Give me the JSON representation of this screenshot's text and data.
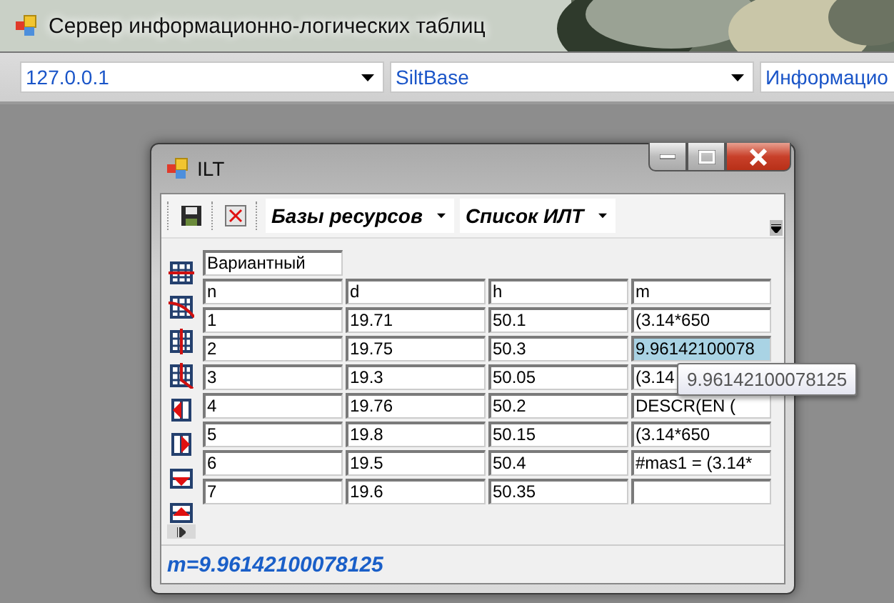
{
  "main_window": {
    "title": "Сервер информационно-логических таблиц",
    "combos": [
      "127.0.0.1",
      "SiltBase",
      "Информацио"
    ]
  },
  "ilt_window": {
    "title": "ILT",
    "toolbar_combos": [
      "Базы ресурсов",
      "Список ИЛТ"
    ],
    "grid": {
      "caption": "Вариантный",
      "columns": [
        "n",
        "d",
        "h",
        "m"
      ],
      "rows": [
        {
          "cells": [
            "1",
            "19.71",
            "50.1",
            "(3.14*650"
          ],
          "selected": false
        },
        {
          "cells": [
            "2",
            "19.75",
            "50.3",
            "9.96142100078"
          ],
          "selected": true
        },
        {
          "cells": [
            "3",
            "19.3",
            "50.05",
            "(3.14"
          ],
          "selected": false
        },
        {
          "cells": [
            "4",
            "19.76",
            "50.2",
            "DESCR(EN ("
          ],
          "selected": false
        },
        {
          "cells": [
            "5",
            "19.8",
            "50.15",
            "(3.14*650"
          ],
          "selected": false
        },
        {
          "cells": [
            "6",
            "19.5",
            "50.4",
            "#mas1 = (3.14*"
          ],
          "selected": false
        },
        {
          "cells": [
            "7",
            "19.6",
            "50.35"
          ],
          "selected": false
        }
      ]
    },
    "tooltip": "9.96142100078125",
    "status": "m=9.96142100078125"
  }
}
